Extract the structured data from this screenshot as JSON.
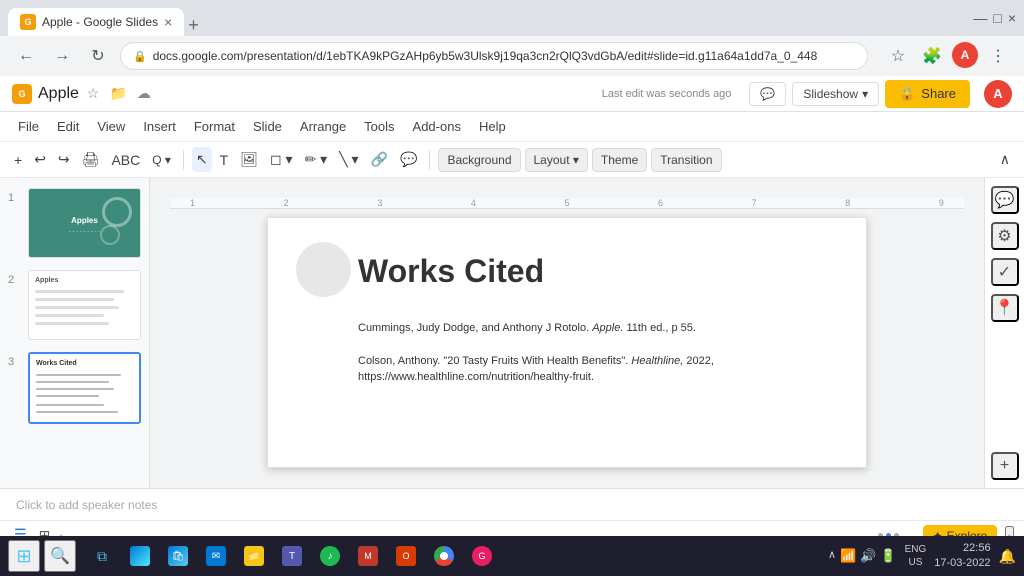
{
  "browser": {
    "tab_title": "Apple - Google Slides",
    "url": "docs.google.com/presentation/d/1ebTKA9kPGzAHp6yb5w3Ulsk9j19qa3cn2rQlQ3vdGbA/edit#slide=id.g11a64a1dd7a_0_448",
    "favicon_text": "G",
    "new_tab_label": "+"
  },
  "app": {
    "title": "Apple",
    "last_edit": "Last edit was seconds ago",
    "slideshow_label": "Slideshow",
    "share_label": "Share",
    "avatar_letter": "A"
  },
  "menu": {
    "items": [
      "File",
      "Edit",
      "View",
      "Insert",
      "Format",
      "Slide",
      "Arrange",
      "Tools",
      "Add-ons",
      "Help"
    ]
  },
  "toolbar": {
    "background_label": "Background",
    "layout_label": "Layout",
    "theme_label": "Theme",
    "transition_label": "Transition"
  },
  "slides": [
    {
      "num": "1",
      "title": "Apples",
      "type": "cover"
    },
    {
      "num": "2",
      "title": "Apples",
      "type": "content"
    },
    {
      "num": "3",
      "title": "Works Cited",
      "type": "citations"
    }
  ],
  "current_slide": {
    "title": "Works Cited",
    "citations": [
      "Cummings, Judy Dodge, and Anthony J Rotolo. Apple. 11th ed., p  55.",
      "Colson, Anthony. \"20 Tasty Fruits With Health Benefits\". Healthline, 2022, https://www.healthline.com/nutrition/healthy-fruit."
    ]
  },
  "citations_italic": [
    "Apple.",
    "Healthline,"
  ],
  "speaker_notes": "Click to add speaker notes",
  "right_sidebar": {
    "icons": [
      "comment",
      "gear",
      "check-circle",
      "location",
      "plus"
    ]
  },
  "bottom_bar": {
    "explore_label": "Explore"
  },
  "ruler_marks": [
    "1",
    "2",
    "3",
    "4",
    "5",
    "6",
    "7",
    "8",
    "9"
  ],
  "taskbar": {
    "time": "22:56",
    "date": "17-03-2022",
    "lang": "ENG\nUS"
  }
}
